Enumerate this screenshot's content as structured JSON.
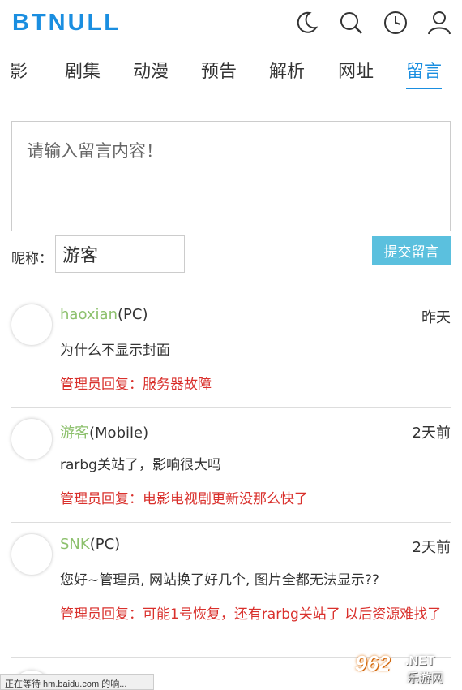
{
  "header": {
    "logo": "BTNULL",
    "icons": [
      "moon-icon",
      "search-icon",
      "clock-icon",
      "user-icon"
    ]
  },
  "nav": {
    "items": [
      "影",
      "剧集",
      "动漫",
      "预告",
      "解析",
      "网址",
      "留言"
    ],
    "active": "留言"
  },
  "form": {
    "placeholder": "请输入留言内容！",
    "nick_label": "昵称：",
    "nick_value": "游客",
    "submit_label": "提交留言"
  },
  "comments": [
    {
      "user": "haoxian",
      "device": "(PC)",
      "time": "昨天",
      "text": "为什么不显示封面",
      "reply": "管理员回复：服务器故障"
    },
    {
      "user": "游客",
      "device": "(Mobile)",
      "time": "2天前",
      "text": "rarbg关站了，影响很大吗",
      "reply": "管理员回复：电影电视剧更新没那么快了"
    },
    {
      "user": "SNK",
      "device": "(PC)",
      "time": "2天前",
      "text": "您好~管理员, 网站换了好几个, 图片全都无法显示??",
      "reply": "管理员回复：可能1号恢复，还有rarbg关站了 以后资源难找了"
    }
  ],
  "status_bar": "正在等待 hm.baidu.com 的响...",
  "watermark": {
    "number": "962",
    "net": ".NET",
    "cn": "乐游网"
  },
  "colors": {
    "accent": "#1a8ee0",
    "username": "#8cc06c",
    "reply": "#d9302c",
    "button": "#5bc0de"
  }
}
